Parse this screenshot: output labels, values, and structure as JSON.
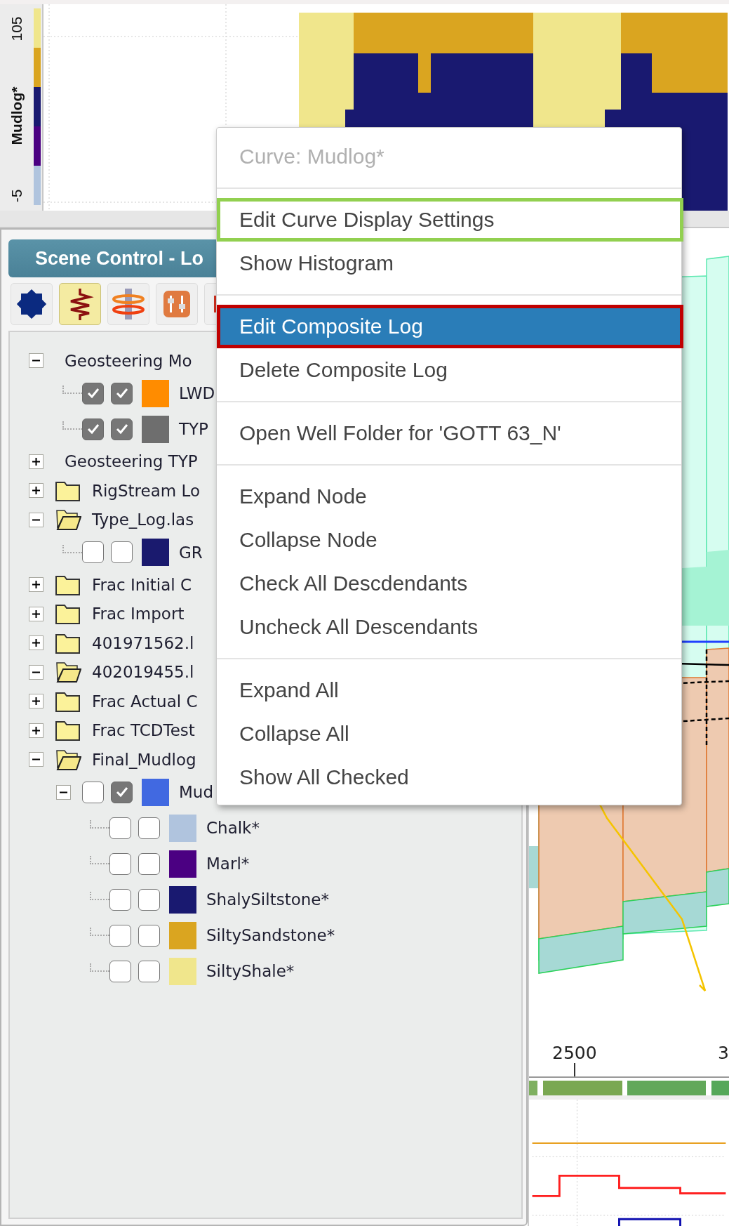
{
  "track": {
    "label": "Mudlog*",
    "max": "105",
    "min": "-5"
  },
  "panel": {
    "title": "Scene Control - Lo",
    "toolbar": [
      {
        "kind": "gear",
        "selected": false
      },
      {
        "kind": "curve",
        "selected": true
      },
      {
        "kind": "layers",
        "selected": false
      },
      {
        "kind": "sliders",
        "selected": false
      },
      {
        "kind": "other",
        "selected": false
      }
    ]
  },
  "tree": [
    {
      "kind": "group",
      "label": "Geosteering Mo",
      "expanded": true,
      "children": [
        {
          "kind": "curve",
          "label": "LWD",
          "checked": [
            true,
            true
          ],
          "color": "#ff8c00"
        },
        {
          "kind": "curve",
          "label": "TYP",
          "checked": [
            true,
            true
          ],
          "color": "#6e6e6e"
        }
      ]
    },
    {
      "kind": "group",
      "label": "Geosteering TYP",
      "expanded": false
    },
    {
      "kind": "folder",
      "label": "RigStream Lo",
      "expanded": false
    },
    {
      "kind": "folder",
      "label": "Type_Log.las",
      "expanded": true,
      "children": [
        {
          "kind": "curve",
          "label": "GR",
          "checked": [
            false,
            false
          ],
          "color": "#1a1a6e"
        }
      ]
    },
    {
      "kind": "folder",
      "label": "Frac Initial C",
      "expanded": false
    },
    {
      "kind": "folder",
      "label": "Frac Import",
      "expanded": false
    },
    {
      "kind": "folder",
      "label": "401971562.l",
      "expanded": false
    },
    {
      "kind": "folder",
      "label": "402019455.l",
      "expanded": true
    },
    {
      "kind": "folder",
      "label": "Frac Actual C",
      "expanded": false
    },
    {
      "kind": "folder",
      "label": "Frac TCDTest",
      "expanded": false
    },
    {
      "kind": "folder",
      "label": "Final_Mudlog",
      "expanded": true,
      "children": [
        {
          "kind": "curve",
          "label": "Mud",
          "expanded": true,
          "checked": [
            false,
            true
          ],
          "color": "#4169e1",
          "children": [
            {
              "kind": "curve",
              "label": "Chalk*",
              "checked": [
                false,
                false
              ],
              "color": "#b0c4de"
            },
            {
              "kind": "curve",
              "label": "Marl*",
              "checked": [
                false,
                false
              ],
              "color": "#4b0082"
            },
            {
              "kind": "curve",
              "label": "ShalySiltstone*",
              "checked": [
                false,
                false
              ],
              "color": "#191970"
            },
            {
              "kind": "curve",
              "label": "SiltySandstone*",
              "checked": [
                false,
                false
              ],
              "color": "#daa520"
            },
            {
              "kind": "curve",
              "label": "SiltyShale*",
              "checked": [
                false,
                false
              ],
              "color": "#f0e68c"
            }
          ]
        }
      ]
    }
  ],
  "depth_axis": {
    "labels": [
      "2500",
      "3"
    ]
  },
  "menu": {
    "items": [
      {
        "kind": "header",
        "label": "Curve: Mudlog*",
        "disabled": true,
        "selected": false
      },
      {
        "kind": "separator"
      },
      {
        "kind": "item",
        "label": "Edit Curve Display Settings",
        "selected": false,
        "color": "#92d050"
      },
      {
        "kind": "item",
        "label": "Show Histogram",
        "selected": false
      },
      {
        "kind": "separator"
      },
      {
        "kind": "item",
        "label": "Edit Composite Log",
        "selected": true,
        "color": "#c00000"
      },
      {
        "kind": "item",
        "label": "Delete Composite Log",
        "selected": false
      },
      {
        "kind": "separator"
      },
      {
        "kind": "item",
        "label": "Open Well Folder for 'GOTT 63_N'",
        "selected": false
      },
      {
        "kind": "separator"
      },
      {
        "kind": "item",
        "label": "Expand Node",
        "selected": false
      },
      {
        "kind": "item",
        "label": "Collapse Node",
        "selected": false
      },
      {
        "kind": "item",
        "label": "Check All Descdendants",
        "selected": false
      },
      {
        "kind": "item",
        "label": "Uncheck All Descendants",
        "selected": false
      },
      {
        "kind": "separator"
      },
      {
        "kind": "item",
        "label": "Expand All",
        "selected": false
      },
      {
        "kind": "item",
        "label": "Collapse All",
        "selected": false
      },
      {
        "kind": "item",
        "label": "Show All Checked",
        "selected": false
      }
    ]
  }
}
